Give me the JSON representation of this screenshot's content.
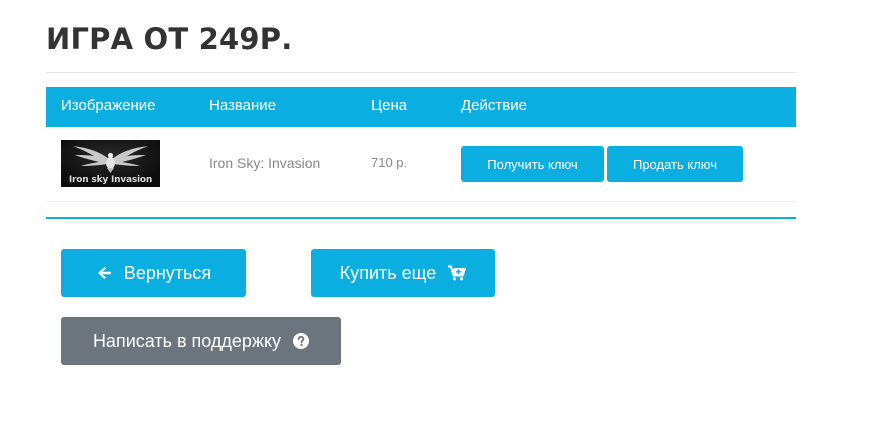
{
  "page": {
    "title": "ИГРА ОТ 249Р."
  },
  "table": {
    "headers": [
      "Изображение",
      "Название",
      "Цена",
      "Действие"
    ],
    "rows": [
      {
        "image_caption": "Iron sky Invasion",
        "name": "Iron Sky: Invasion",
        "price": "710 р.",
        "get_key_label": "Получить ключ",
        "sell_key_label": "Продать ключ"
      }
    ]
  },
  "actions": {
    "back_label": "Вернуться",
    "buy_more_label": "Купить еще",
    "support_label": "Написать в поддержку"
  },
  "icons": {
    "back": "arrow-left-icon",
    "buy_more": "cart-plus-icon",
    "support": "question-circle-icon"
  },
  "colors": {
    "accent": "#0baee0",
    "secondary": "#6c757d",
    "title": "#333333",
    "muted_text": "#888888"
  }
}
